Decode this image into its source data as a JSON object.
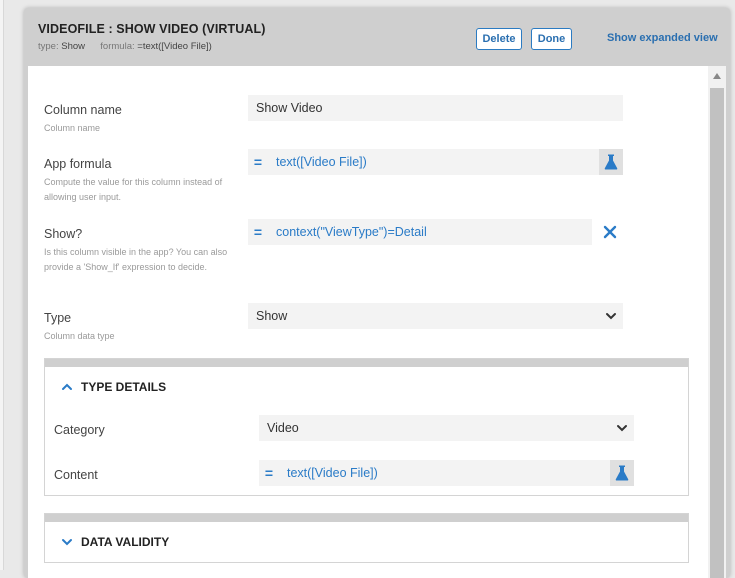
{
  "dialog": {
    "title": "VIDEOFILE : SHOW VIDEO (VIRTUAL)",
    "type_label": "type:",
    "type_value": "Show",
    "formula_label": "formula:",
    "formula_value": "=text([Video File])",
    "delete_label": "Delete",
    "done_label": "Done",
    "expand_label": "Show expanded view"
  },
  "fields": {
    "column_name": {
      "label": "Column name",
      "help": "Column name",
      "value": "Show Video"
    },
    "app_formula": {
      "label": "App formula",
      "help": "Compute the value for this column instead of allowing user input.",
      "eq": "=",
      "value": "text([Video File])"
    },
    "show": {
      "label": "Show?",
      "help": "Is this column visible in the app? You can also provide a 'Show_If' expression to decide.",
      "eq": "=",
      "value": "context(\"ViewType\")=Detail"
    },
    "type": {
      "label": "Type",
      "help": "Column data type",
      "value": "Show"
    }
  },
  "type_details": {
    "heading": "TYPE DETAILS",
    "category_label": "Category",
    "category_value": "Video",
    "content_label": "Content",
    "content_eq": "=",
    "content_value": "text([Video File])"
  },
  "data_validity": {
    "heading": "DATA VALIDITY"
  },
  "colors": {
    "accent": "#2a7bc7",
    "header_bg": "#cfcfcf",
    "field_bg": "#f3f3f3"
  },
  "icons": {
    "formula_test": "flask-icon",
    "clear": "close-icon",
    "collapse": "chevron-up-icon",
    "expand": "chevron-down-icon"
  }
}
